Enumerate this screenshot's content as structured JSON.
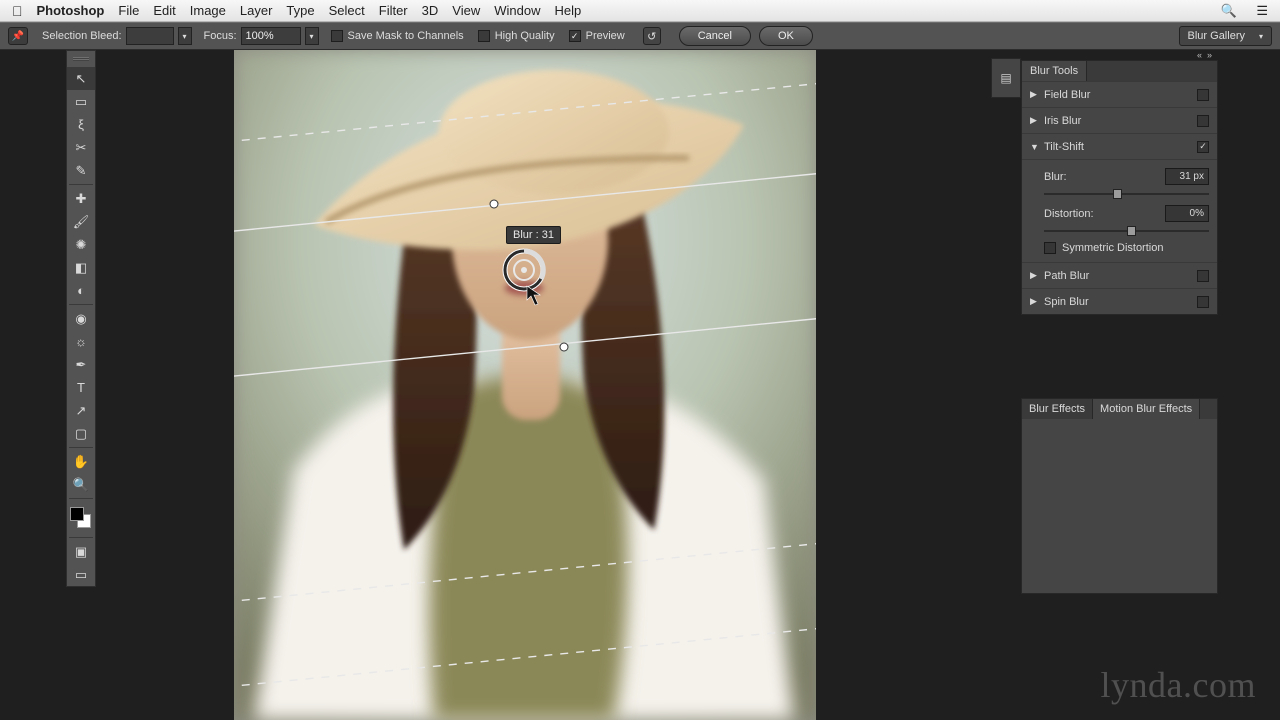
{
  "menubar": {
    "app": "Photoshop",
    "items": [
      "File",
      "Edit",
      "Image",
      "Layer",
      "Type",
      "Select",
      "Filter",
      "3D",
      "View",
      "Window",
      "Help"
    ]
  },
  "optionsbar": {
    "selection_bleed_label": "Selection Bleed:",
    "focus_label": "Focus:",
    "focus_value": "100%",
    "save_mask": "Save Mask to Channels",
    "high_quality": "High Quality",
    "preview": "Preview",
    "cancel": "Cancel",
    "ok": "OK",
    "dropdown": "Blur Gallery"
  },
  "tools": [
    "move",
    "marquee",
    "lasso",
    "crop",
    "eyedropper",
    "brush",
    "pencil",
    "clone",
    "eraser",
    "gradient",
    "blur",
    "dodge",
    "pen",
    "type",
    "path",
    "rect",
    "hand",
    "zoom"
  ],
  "blur_tools": {
    "panel_title": "Blur Tools",
    "items": [
      {
        "name": "Field Blur",
        "checked": false,
        "expanded": false
      },
      {
        "name": "Iris Blur",
        "checked": false,
        "expanded": false
      },
      {
        "name": "Tilt-Shift",
        "checked": true,
        "expanded": true,
        "controls": {
          "blur_label": "Blur:",
          "blur_value": "31 px",
          "distortion_label": "Distortion:",
          "distortion_value": "0%",
          "symmetric": "Symmetric Distortion"
        }
      },
      {
        "name": "Path Blur",
        "checked": false,
        "expanded": false
      },
      {
        "name": "Spin Blur",
        "checked": false,
        "expanded": false
      }
    ]
  },
  "effects_tabs": {
    "t1": "Blur Effects",
    "t2": "Motion Blur Effects"
  },
  "canvas_overlay": {
    "tooltip": "Blur : 31"
  },
  "watermark": "lynda.com"
}
